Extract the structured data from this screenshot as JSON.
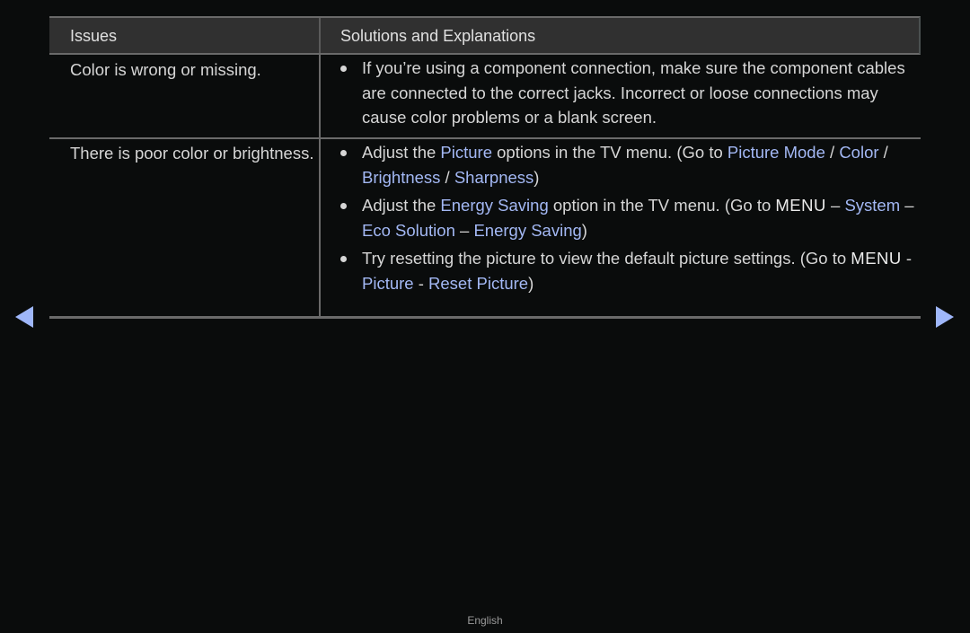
{
  "table": {
    "headers": {
      "issues": "Issues",
      "solutions": "Solutions and Explanations"
    },
    "rows": [
      {
        "issue": "Color is wrong or missing.",
        "bullets": [
          {
            "segments": [
              {
                "text": "If you’re using a component connection, make sure the component cables are connected to the correct jacks. Incorrect or loose connections may cause color problems or a blank screen.",
                "style": "plain"
              }
            ]
          }
        ]
      },
      {
        "issue": "There is poor color or brightness.",
        "bullets": [
          {
            "segments": [
              {
                "text": "Adjust the ",
                "style": "plain"
              },
              {
                "text": "Picture",
                "style": "link"
              },
              {
                "text": " options in the TV menu. (Go to ",
                "style": "plain"
              },
              {
                "text": "Picture Mode",
                "style": "link"
              },
              {
                "text": " / ",
                "style": "plain"
              },
              {
                "text": "Color",
                "style": "link"
              },
              {
                "text": " / ",
                "style": "plain"
              },
              {
                "text": "Brightness",
                "style": "link"
              },
              {
                "text": " / ",
                "style": "plain"
              },
              {
                "text": "Sharpness",
                "style": "link"
              },
              {
                "text": ")",
                "style": "plain"
              }
            ]
          },
          {
            "segments": [
              {
                "text": "Adjust the ",
                "style": "plain"
              },
              {
                "text": "Energy Saving",
                "style": "link"
              },
              {
                "text": " option in the TV menu. (Go to ",
                "style": "plain"
              },
              {
                "text": "MENU",
                "style": "menu"
              },
              {
                "text": " – ",
                "style": "plain"
              },
              {
                "text": "System",
                "style": "link"
              },
              {
                "text": " – ",
                "style": "plain"
              },
              {
                "text": "Eco Solution",
                "style": "link"
              },
              {
                "text": " – ",
                "style": "plain"
              },
              {
                "text": "Energy Saving",
                "style": "link"
              },
              {
                "text": ")",
                "style": "plain"
              }
            ]
          },
          {
            "segments": [
              {
                "text": "Try resetting the picture to view the default picture settings. (Go to ",
                "style": "plain"
              },
              {
                "text": "MENU",
                "style": "menu"
              },
              {
                "text": " - ",
                "style": "plain"
              },
              {
                "text": "Picture",
                "style": "link"
              },
              {
                "text": " - ",
                "style": "plain"
              },
              {
                "text": "Reset Picture",
                "style": "link"
              },
              {
                "text": ")",
                "style": "plain"
              }
            ]
          }
        ]
      }
    ]
  },
  "navigation": {
    "prev_icon": "triangle-left-icon",
    "next_icon": "triangle-right-icon"
  },
  "footer": {
    "language": "English"
  },
  "colors": {
    "background": "#0a0c0c",
    "link": "#a3b8f4",
    "arrow": "#9fb7fa",
    "header_bg": "#303030"
  }
}
